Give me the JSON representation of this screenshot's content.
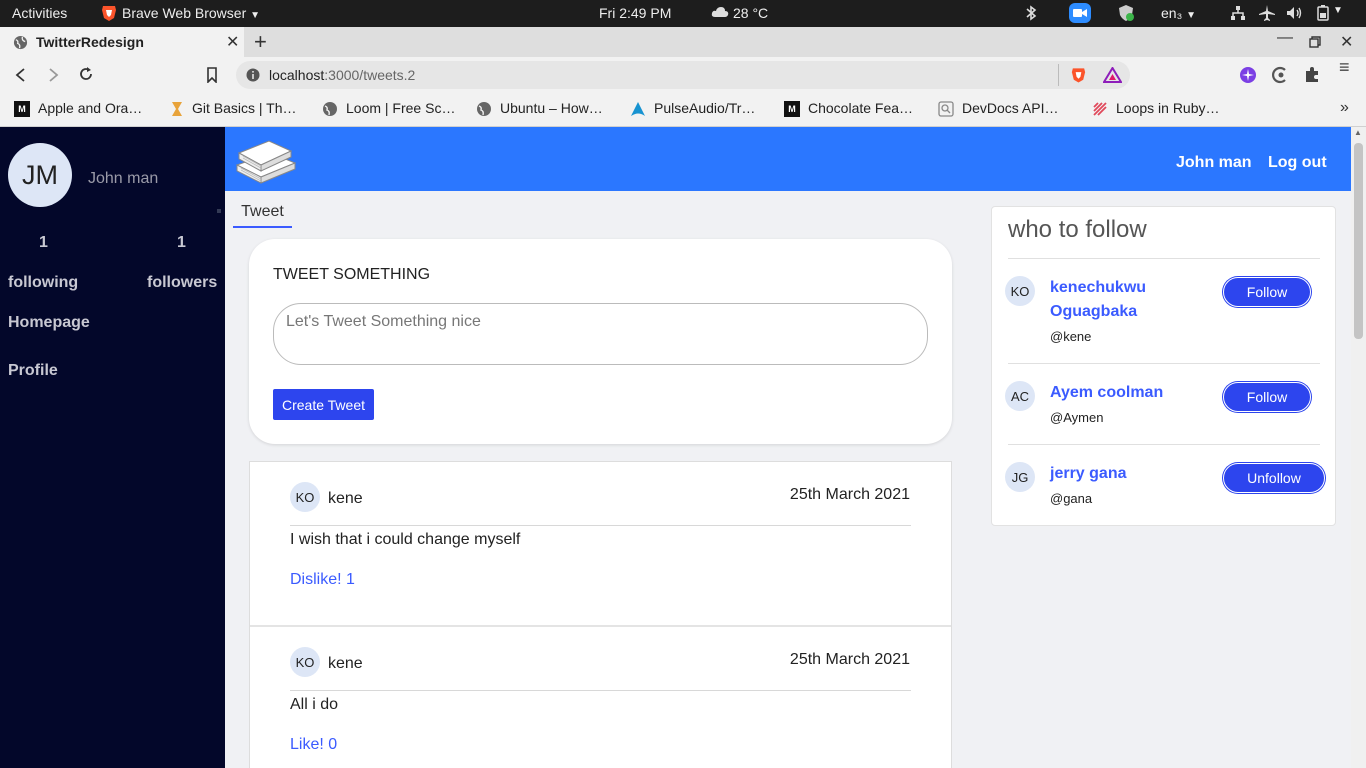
{
  "system": {
    "activities": "Activities",
    "app_name": "Brave Web Browser",
    "clock": "Fri  2:49 PM",
    "weather": "28 °C",
    "lang": "en₃"
  },
  "browser": {
    "tab_title": "TwitterRedesign",
    "url_host": "localhost",
    "url_rest": ":3000/tweets.2",
    "bookmarks": [
      {
        "label": "Apple and Ora…"
      },
      {
        "label": "Git Basics | Th…"
      },
      {
        "label": "Loom | Free Sc…"
      },
      {
        "label": "Ubuntu – How…"
      },
      {
        "label": "PulseAudio/Tr…"
      },
      {
        "label": "Chocolate Fea…"
      },
      {
        "label": "DevDocs API…"
      },
      {
        "label": "Loops in Ruby…"
      }
    ]
  },
  "sidebar": {
    "initials": "JM",
    "name": "John man",
    "following_count": "1",
    "following_label": "following",
    "followers_count": "1",
    "followers_label": "followers",
    "homepage": "Homepage",
    "profile": "Profile"
  },
  "header": {
    "user": "John man",
    "logout": "Log out"
  },
  "tab": {
    "label": "Tweet"
  },
  "compose": {
    "title": "TWEET SOMETHING",
    "placeholder": "Let's Tweet Something nice",
    "button": "Create Tweet"
  },
  "tweets": [
    {
      "initials": "KO",
      "user": "kene",
      "date": "25th March 2021",
      "body": "I wish that i could change myself",
      "like": "Dislike! 1"
    },
    {
      "initials": "KO",
      "user": "kene",
      "date": "25th March 2021",
      "body": "All i do",
      "like": "Like! 0"
    }
  ],
  "who_to_follow": {
    "title": "who to follow",
    "items": [
      {
        "initials": "KO",
        "name": "kenechukwu Oguagbaka",
        "handle": "@kene",
        "action": "Follow"
      },
      {
        "initials": "AC",
        "name": "Ayem coolman",
        "handle": "@Aymen",
        "action": "Follow"
      },
      {
        "initials": "JG",
        "name": "jerry gana",
        "handle": "@gana",
        "action": "Unfollow"
      }
    ]
  },
  "colors": {
    "accent": "#2b77ff",
    "button": "#2d45ee",
    "link": "#3b5bff",
    "sidebar": "#03072a"
  }
}
